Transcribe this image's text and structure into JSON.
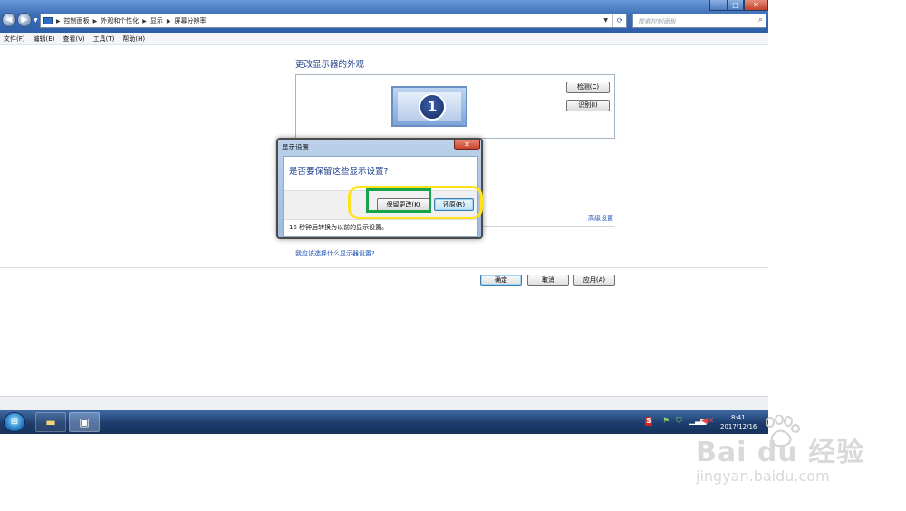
{
  "address": {
    "breadcrumb": [
      "控制面板",
      "外观和个性化",
      "显示",
      "屏幕分辨率"
    ],
    "search_placeholder": "搜索控制面板"
  },
  "menu": [
    "文件(F)",
    "编辑(E)",
    "查看(V)",
    "工具(T)",
    "帮助(H)"
  ],
  "page": {
    "title": "更改显示器的外观",
    "monitor_number": "1",
    "detect_label": "检测(C)",
    "identify_label": "识别(I)",
    "advanced_link": "高级设置",
    "help_link": "我应该选择什么显示器设置?",
    "ok_label": "确定",
    "cancel_label": "取消",
    "apply_label": "应用(A)"
  },
  "dialog": {
    "title": "显示设置",
    "question": "是否要保留这些显示设置?",
    "keep_label": "保留更改(K)",
    "revert_label": "还原(R)",
    "countdown": "15 秒钟后转换为以前的显示设置。"
  },
  "taskbar": {
    "time": "8:41",
    "date": "2017/12/16"
  },
  "watermark": {
    "logo": "Bai du 经验",
    "url": "jingyan.baidu.com"
  },
  "colors": {
    "dialog_question": "#1e3d8c",
    "highlight_yellow": "#ffe31a",
    "highlight_green": "#16a34a",
    "link": "#1a4fb3"
  }
}
